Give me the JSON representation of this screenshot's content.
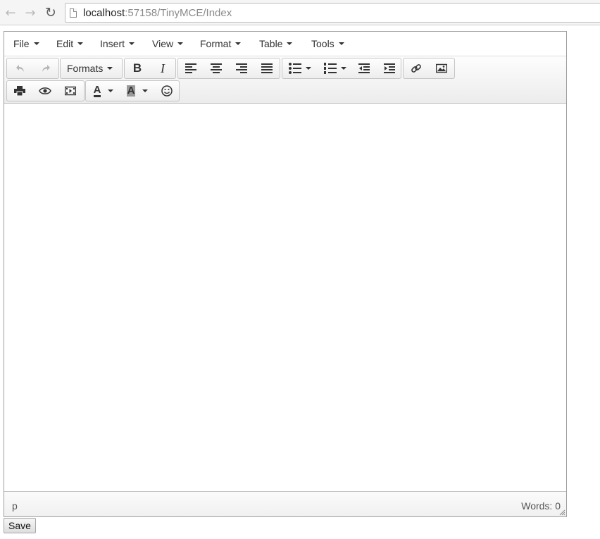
{
  "browser": {
    "url_host": "localhost",
    "url_path": ":57158/TinyMCE/Index",
    "back_icon": "arrow-left-icon",
    "forward_icon": "arrow-right-icon",
    "reload_icon": "reload-icon"
  },
  "menubar": {
    "items": [
      {
        "label": "File"
      },
      {
        "label": "Edit"
      },
      {
        "label": "Insert"
      },
      {
        "label": "View"
      },
      {
        "label": "Format"
      },
      {
        "label": "Table"
      },
      {
        "label": "Tools"
      }
    ]
  },
  "toolbar": {
    "formats_label": "Formats",
    "bold_label": "B",
    "italic_label": "I",
    "forecolor_label": "A",
    "backcolor_label": "A"
  },
  "statusbar": {
    "path": "p",
    "wordcount": "Words: 0"
  },
  "save_label": "Save"
}
